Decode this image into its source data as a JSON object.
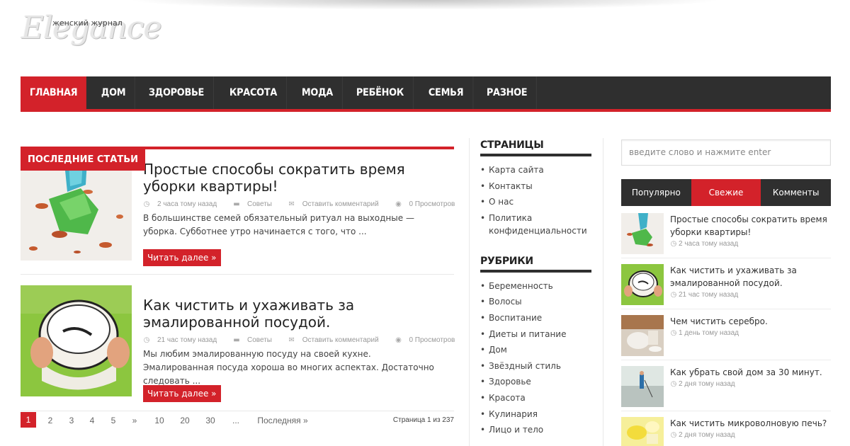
{
  "logo": {
    "script": "Elegance",
    "sub": "женский журнал"
  },
  "nav": [
    "ГЛАВНАЯ",
    "ДОМ",
    "ЗДОРОВЬЕ",
    "КРАСОТА",
    "МОДА",
    "РЕБЁНОК",
    "СЕМЬЯ",
    "РАЗНОЕ"
  ],
  "main": {
    "section_label": "ПОСЛЕДНИЕ СТАТЬИ",
    "articles": [
      {
        "title": "Простые способы сократить время уборки квартиры!",
        "time": "2 часа тому назад",
        "category": "Советы",
        "comments": "Оставить комментарий",
        "views": "0 Просмотров",
        "excerpt": "В большинстве семей обязательный ритуал на выходные — уборка. Субботнее утро начинается с того, что ...",
        "read_more": "Читать далее »"
      },
      {
        "title": "Как чистить и ухаживать за эмалированной посудой.",
        "time": "21 час тому назад",
        "category": "Советы",
        "comments": "Оставить комментарий",
        "views": "0 Просмотров",
        "excerpt": "Мы любим эмалированную посуду на своей кухне. Эмалированная посуда хороша во многих аспектах. Достаточно следовать ...",
        "read_more": "Читать далее »"
      }
    ],
    "pagination": {
      "pages": [
        "1",
        "2",
        "3",
        "4",
        "5",
        "»",
        "10",
        "20",
        "30",
        "...",
        "Последняя »"
      ],
      "info": "Страница 1 из 237"
    }
  },
  "pages_widget": {
    "title": "СТРАНИЦЫ",
    "items": [
      "Карта сайта",
      "Контакты",
      "О нас",
      "Политика конфиденциальности"
    ]
  },
  "rubrics_widget": {
    "title": "РУБРИКИ",
    "items": [
      "Беременность",
      "Волосы",
      "Воспитание",
      "Диеты и питание",
      "Дом",
      "Звёздный стиль",
      "Здоровье",
      "Красота",
      "Кулинария",
      "Лицо и тело"
    ]
  },
  "search": {
    "placeholder": "введите слово и нажмите enter"
  },
  "tabs": [
    "Популярно",
    "Свежие",
    "Комменты"
  ],
  "recent": [
    {
      "title": "Простые способы сократить время уборки квартиры!",
      "date": "2 часа тому назад"
    },
    {
      "title": "Как чистить и ухаживать за эмалированной посудой.",
      "date": "21 час тому назад"
    },
    {
      "title": "Чем чистить серебро.",
      "date": "1 день тому назад"
    },
    {
      "title": "Как убрать свой дом за 30 минут.",
      "date": "2 дня тому назад"
    },
    {
      "title": "Как чистить микроволновую печь?",
      "date": "2 дня тому назад"
    }
  ],
  "colors": {
    "accent": "#d3222a",
    "dark": "#2f2f2f"
  }
}
